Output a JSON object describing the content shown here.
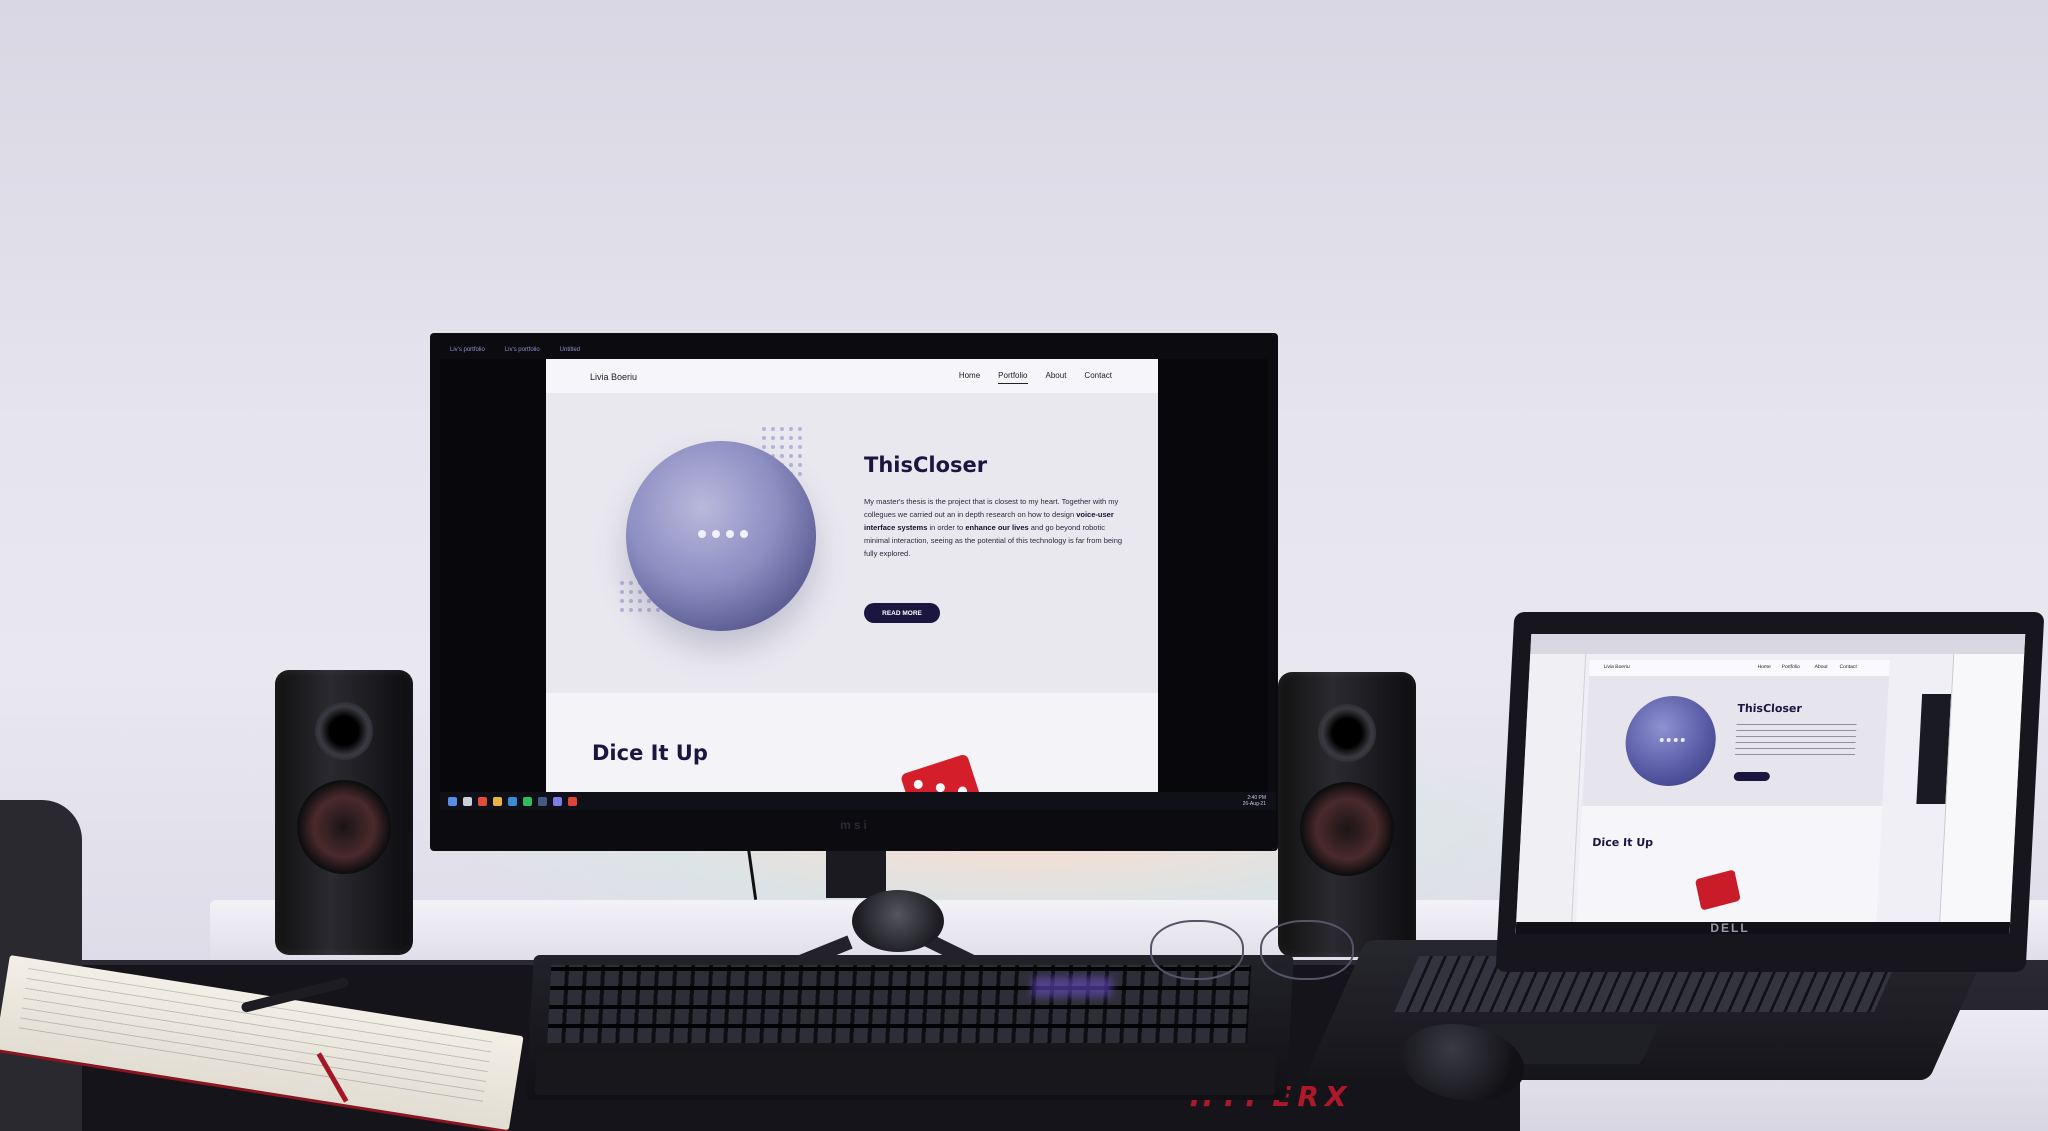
{
  "monitor": {
    "topbar_tabs": [
      "Liv's portfolio",
      "Liv's portfolio",
      "Untitled"
    ],
    "brand": "msi",
    "clock": {
      "time": "2:40 PM",
      "date": "26-Aug-21"
    }
  },
  "site": {
    "brand": "Livia Boeriu",
    "nav": [
      "Home",
      "Portfolio",
      "About",
      "Contact"
    ],
    "active_nav": "Portfolio",
    "hero": {
      "title": "ThisCloser",
      "text_parts": [
        "My master's thesis is the project that is closest to my heart. Together with my collegues we carried out an in depth research on how to design ",
        "voice-user interface systems",
        " in order to ",
        "enhance our lives",
        " and go beyond robotic minimal interaction, seeing as the potential of this technology is far from being fully explored."
      ],
      "button": "READ MORE"
    },
    "section2_title": "Dice It Up"
  },
  "laptop": {
    "brand": "DELL",
    "site_brand": "Livia Boeriu",
    "nav": [
      "Home",
      "Portfolio",
      "About",
      "Contact"
    ],
    "hero_title": "ThisCloser",
    "section2_title": "Dice It Up"
  },
  "deskpad": {
    "logo": "HYPERX"
  },
  "colors": {
    "navy": "#1a1640",
    "sphere": "#8d8ec2",
    "dice": "#d41f2a",
    "deskpad_logo": "#c91a2c"
  },
  "icons": [
    "windows-start-icon",
    "search-icon",
    "browser-icon",
    "folder-icon",
    "vscode-icon",
    "spotify-icon",
    "steam-icon",
    "discord-icon",
    "chrome-icon"
  ]
}
